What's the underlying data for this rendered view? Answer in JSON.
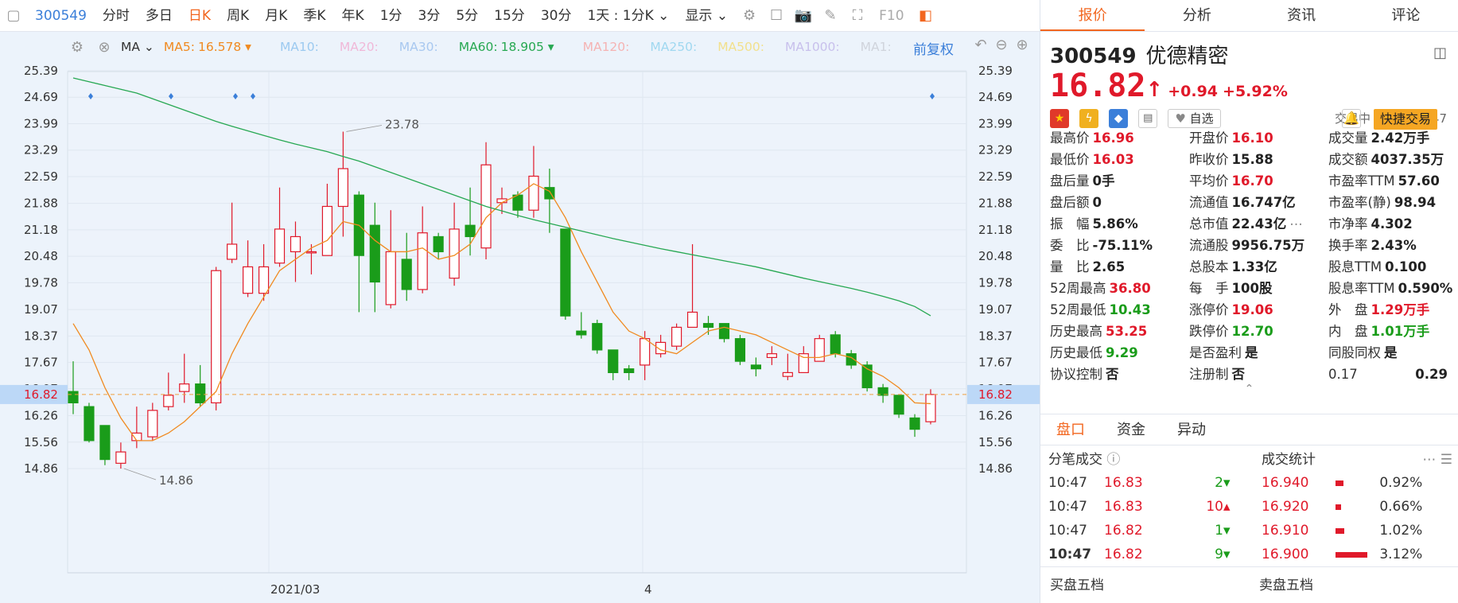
{
  "toolbar": {
    "code": "300549",
    "tabs": [
      "分时",
      "多日",
      "日K",
      "周K",
      "月K",
      "季K",
      "年K",
      "1分",
      "3分",
      "5分",
      "15分",
      "30分"
    ],
    "active": "日K",
    "period_select": "1天 : 1分K",
    "display": "显示",
    "f10": "F10"
  },
  "ma_bar": {
    "label": "MA",
    "items": [
      {
        "text": "MA5:",
        "value": "16.578",
        "color": "#f08a20"
      },
      {
        "text": "MA10:",
        "value": "",
        "color": "#9ccaf0"
      },
      {
        "text": "MA20:",
        "value": "",
        "color": "#f0b8d8"
      },
      {
        "text": "MA30:",
        "value": "",
        "color": "#a8c8f0"
      },
      {
        "text": "MA60:",
        "value": "18.905",
        "color": "#27a852"
      },
      {
        "text": "MA120:",
        "value": "",
        "color": "#f5b3b3"
      },
      {
        "text": "MA250:",
        "value": "",
        "color": "#a0d8f0"
      },
      {
        "text": "MA500:",
        "value": "",
        "color": "#f2e08c"
      },
      {
        "text": "MA1000:",
        "value": "",
        "color": "#c8c0ec"
      },
      {
        "text": "MA1:",
        "value": "",
        "color": "#d0d4dc"
      }
    ],
    "fq": "前复权"
  },
  "chart_data": {
    "type": "candlestick",
    "y_ticks": [
      "25.39",
      "24.69",
      "23.99",
      "23.29",
      "22.59",
      "21.88",
      "21.18",
      "20.48",
      "19.78",
      "19.07",
      "18.37",
      "17.67",
      "16.97",
      "16.26",
      "15.56",
      "14.86"
    ],
    "x_labels": [
      "2021/03",
      "4"
    ],
    "current_price_label": "16.82",
    "annotations": [
      {
        "text": "23.78"
      },
      {
        "text": "14.86"
      }
    ],
    "candles": [
      [
        16.9,
        16.6,
        17.7,
        16.3
      ],
      [
        16.5,
        15.6,
        16.6,
        15.55
      ],
      [
        16.0,
        15.1,
        16.0,
        14.95
      ],
      [
        15.0,
        15.3,
        15.55,
        14.86
      ],
      [
        15.6,
        15.8,
        16.5,
        15.4
      ],
      [
        15.7,
        16.4,
        16.6,
        15.6
      ],
      [
        16.5,
        16.8,
        17.4,
        16.4
      ],
      [
        16.9,
        17.1,
        17.9,
        16.6
      ],
      [
        17.1,
        16.6,
        17.6,
        16.5
      ],
      [
        16.6,
        20.1,
        20.2,
        16.4
      ],
      [
        20.4,
        20.8,
        21.9,
        20.3
      ],
      [
        19.5,
        20.2,
        20.9,
        19.4
      ],
      [
        19.5,
        20.2,
        20.8,
        19.3
      ],
      [
        20.3,
        21.2,
        22.3,
        20.2
      ],
      [
        20.6,
        21.0,
        21.4,
        19.8
      ],
      [
        20.6,
        20.6,
        20.8,
        20.0
      ],
      [
        20.5,
        21.8,
        22.4,
        20.5
      ],
      [
        21.8,
        22.8,
        23.78,
        21.0
      ],
      [
        22.1,
        20.5,
        22.2,
        19.0
      ],
      [
        21.3,
        19.8,
        21.9,
        19.0
      ],
      [
        19.2,
        20.6,
        21.7,
        19.1
      ],
      [
        20.4,
        19.6,
        21.1,
        19.3
      ],
      [
        19.6,
        21.1,
        21.8,
        19.5
      ],
      [
        21.0,
        20.6,
        21.1,
        20.4
      ],
      [
        19.9,
        21.2,
        21.9,
        19.7
      ],
      [
        21.3,
        21.0,
        22.3,
        20.5
      ],
      [
        20.7,
        22.9,
        23.5,
        20.4
      ],
      [
        21.9,
        22.0,
        22.3,
        21.6
      ],
      [
        22.1,
        21.7,
        22.2,
        21.5
      ],
      [
        21.7,
        22.6,
        23.4,
        21.5
      ],
      [
        22.3,
        22.0,
        22.8,
        21.1
      ],
      [
        21.2,
        18.9,
        21.2,
        18.8
      ],
      [
        18.5,
        18.4,
        19.0,
        18.3
      ],
      [
        18.7,
        18.0,
        18.8,
        17.9
      ],
      [
        18.0,
        17.4,
        18.0,
        17.2
      ],
      [
        17.5,
        17.4,
        17.6,
        17.2
      ],
      [
        17.6,
        18.3,
        18.5,
        17.2
      ],
      [
        17.9,
        18.2,
        18.4,
        17.8
      ],
      [
        18.1,
        18.6,
        18.7,
        18.0
      ],
      [
        18.6,
        19.0,
        20.8,
        18.6
      ],
      [
        18.7,
        18.6,
        18.9,
        18.4
      ],
      [
        18.7,
        18.3,
        18.7,
        18.2
      ],
      [
        18.3,
        17.7,
        18.4,
        17.6
      ],
      [
        17.6,
        17.5,
        17.8,
        17.3
      ],
      [
        17.8,
        17.9,
        18.1,
        17.6
      ],
      [
        17.3,
        17.4,
        17.9,
        17.2
      ],
      [
        17.4,
        17.9,
        18.1,
        17.4
      ],
      [
        17.7,
        18.3,
        18.4,
        17.7
      ],
      [
        18.4,
        17.9,
        18.5,
        17.8
      ],
      [
        17.9,
        17.6,
        18.0,
        17.5
      ],
      [
        17.6,
        17.0,
        17.7,
        16.9
      ],
      [
        17.0,
        16.8,
        17.1,
        16.6
      ],
      [
        16.8,
        16.3,
        16.8,
        16.2
      ],
      [
        16.2,
        15.9,
        16.3,
        15.7
      ],
      [
        16.1,
        16.82,
        16.96,
        16.03
      ]
    ],
    "ma5": [
      18.7,
      18.0,
      17.0,
      16.2,
      15.6,
      15.6,
      15.8,
      16.1,
      16.5,
      16.9,
      17.9,
      18.7,
      19.4,
      20.1,
      20.4,
      20.7,
      20.9,
      21.4,
      21.3,
      20.9,
      20.6,
      20.6,
      20.7,
      20.4,
      20.5,
      20.8,
      21.5,
      21.9,
      22.1,
      22.4,
      22.2,
      21.5,
      20.6,
      19.8,
      19.0,
      18.5,
      18.3,
      18.0,
      17.9,
      18.2,
      18.5,
      18.6,
      18.5,
      18.4,
      18.2,
      18.0,
      17.8,
      17.8,
      17.9,
      17.8,
      17.5,
      17.3,
      17.0,
      16.6,
      16.578
    ],
    "ma60": [
      25.2,
      25.1,
      25.0,
      24.9,
      24.8,
      24.65,
      24.5,
      24.35,
      24.2,
      24.05,
      23.92,
      23.8,
      23.68,
      23.56,
      23.45,
      23.35,
      23.25,
      23.12,
      23.0,
      22.85,
      22.7,
      22.55,
      22.4,
      22.25,
      22.1,
      21.95,
      21.8,
      21.68,
      21.56,
      21.45,
      21.35,
      21.25,
      21.15,
      21.05,
      20.95,
      20.86,
      20.77,
      20.68,
      20.6,
      20.52,
      20.44,
      20.36,
      20.28,
      20.2,
      20.1,
      20.0,
      19.9,
      19.81,
      19.72,
      19.63,
      19.53,
      19.42,
      19.3,
      19.15,
      18.905
    ]
  },
  "right": {
    "tabs": [
      "报价",
      "分析",
      "资讯",
      "评论"
    ],
    "active": "报价",
    "code": "300549",
    "name": "优德精密",
    "price": "16.82",
    "change": "+0.94",
    "change_pct": "+5.92%",
    "status": "交易中 04/28 10:47",
    "watchlist": "自选",
    "quick_trade": "快捷交易",
    "stats": [
      [
        {
          "l": "最高价",
          "v": "16.96",
          "c": "red"
        },
        {
          "l": "开盘价",
          "v": "16.10",
          "c": "red"
        },
        {
          "l": "成交量",
          "v": "2.42万手",
          "c": "dark"
        }
      ],
      [
        {
          "l": "最低价",
          "v": "16.03",
          "c": "red"
        },
        {
          "l": "昨收价",
          "v": "15.88",
          "c": "dark"
        },
        {
          "l": "成交额",
          "v": "4037.35万",
          "c": "dark"
        }
      ],
      [
        {
          "l": "盘后量",
          "v": "0手",
          "c": "dark"
        },
        {
          "l": "平均价",
          "v": "16.70",
          "c": "red"
        },
        {
          "l": "市盈率TTM",
          "v": "57.60",
          "c": "dark"
        }
      ],
      [
        {
          "l": "盘后额",
          "v": "0",
          "c": "dark"
        },
        {
          "l": "流通值",
          "v": "16.747亿",
          "c": "dark"
        },
        {
          "l": "市盈率(静)",
          "v": "98.94",
          "c": "dark"
        }
      ],
      [
        {
          "l": "振　幅",
          "v": "5.86%",
          "c": "dark"
        },
        {
          "l": "总市值",
          "v": "22.43亿",
          "c": "dark"
        },
        {
          "l": "市净率",
          "v": "4.302",
          "c": "dark"
        }
      ],
      [
        {
          "l": "委　比",
          "v": "-75.11%",
          "c": "dark"
        },
        {
          "l": "流通股",
          "v": "9956.75万",
          "c": "dark"
        },
        {
          "l": "换手率",
          "v": "2.43%",
          "c": "dark"
        }
      ],
      [
        {
          "l": "量　比",
          "v": "2.65",
          "c": "dark"
        },
        {
          "l": "总股本",
          "v": "1.33亿",
          "c": "dark"
        },
        {
          "l": "股息TTM",
          "v": "0.100",
          "c": "dark"
        }
      ],
      [
        {
          "l": "52周最高",
          "v": "36.80",
          "c": "red"
        },
        {
          "l": "每　手",
          "v": "100股",
          "c": "dark"
        },
        {
          "l": "股息率TTM",
          "v": "0.590%",
          "c": "dark"
        }
      ],
      [
        {
          "l": "52周最低",
          "v": "10.43",
          "c": "green"
        },
        {
          "l": "涨停价",
          "v": "19.06",
          "c": "red"
        },
        {
          "l": "外　盘",
          "v": "1.29万手",
          "c": "red"
        }
      ],
      [
        {
          "l": "历史最高",
          "v": "53.25",
          "c": "red"
        },
        {
          "l": "跌停价",
          "v": "12.70",
          "c": "green"
        },
        {
          "l": "内　盘",
          "v": "1.01万手",
          "c": "green"
        }
      ],
      [
        {
          "l": "历史最低",
          "v": "9.29",
          "c": "green"
        },
        {
          "l": "是否盈利",
          "v": "是",
          "c": "dark"
        },
        {
          "l": "同股同权",
          "v": "是",
          "c": "dark"
        }
      ],
      [
        {
          "l": "协议控制",
          "v": "否",
          "c": "dark"
        },
        {
          "l": "注册制",
          "v": "否",
          "c": "dark"
        },
        {
          "l": "0.17",
          "v": "0.29",
          "c": "dark"
        }
      ]
    ],
    "subtabs": [
      "盘口",
      "资金",
      "异动"
    ],
    "subactive": "盘口",
    "trades_title": "分笔成交",
    "trades": [
      {
        "t": "10:47",
        "p": "16.83",
        "q": "2",
        "d": "down"
      },
      {
        "t": "10:47",
        "p": "16.83",
        "q": "10",
        "d": "up"
      },
      {
        "t": "10:47",
        "p": "16.82",
        "q": "1",
        "d": "down"
      },
      {
        "t": "10:47",
        "p": "16.82",
        "q": "9",
        "d": "down"
      }
    ],
    "stat_title": "成交统计",
    "stat_rows": [
      {
        "p": "16.940",
        "pct": "0.92%",
        "bar": 0.2
      },
      {
        "p": "16.920",
        "pct": "0.66%",
        "bar": 0.15
      },
      {
        "p": "16.910",
        "pct": "1.02%",
        "bar": 0.22
      },
      {
        "p": "16.900",
        "pct": "3.12%",
        "bar": 0.8
      }
    ],
    "buy5": "买盘五档",
    "sell5": "卖盘五档"
  },
  "colors": {
    "up": "#e0192a",
    "down": "#1a9c1a",
    "accent": "#f2661f",
    "ma5": "#f08a20",
    "ma60": "#27a852"
  }
}
